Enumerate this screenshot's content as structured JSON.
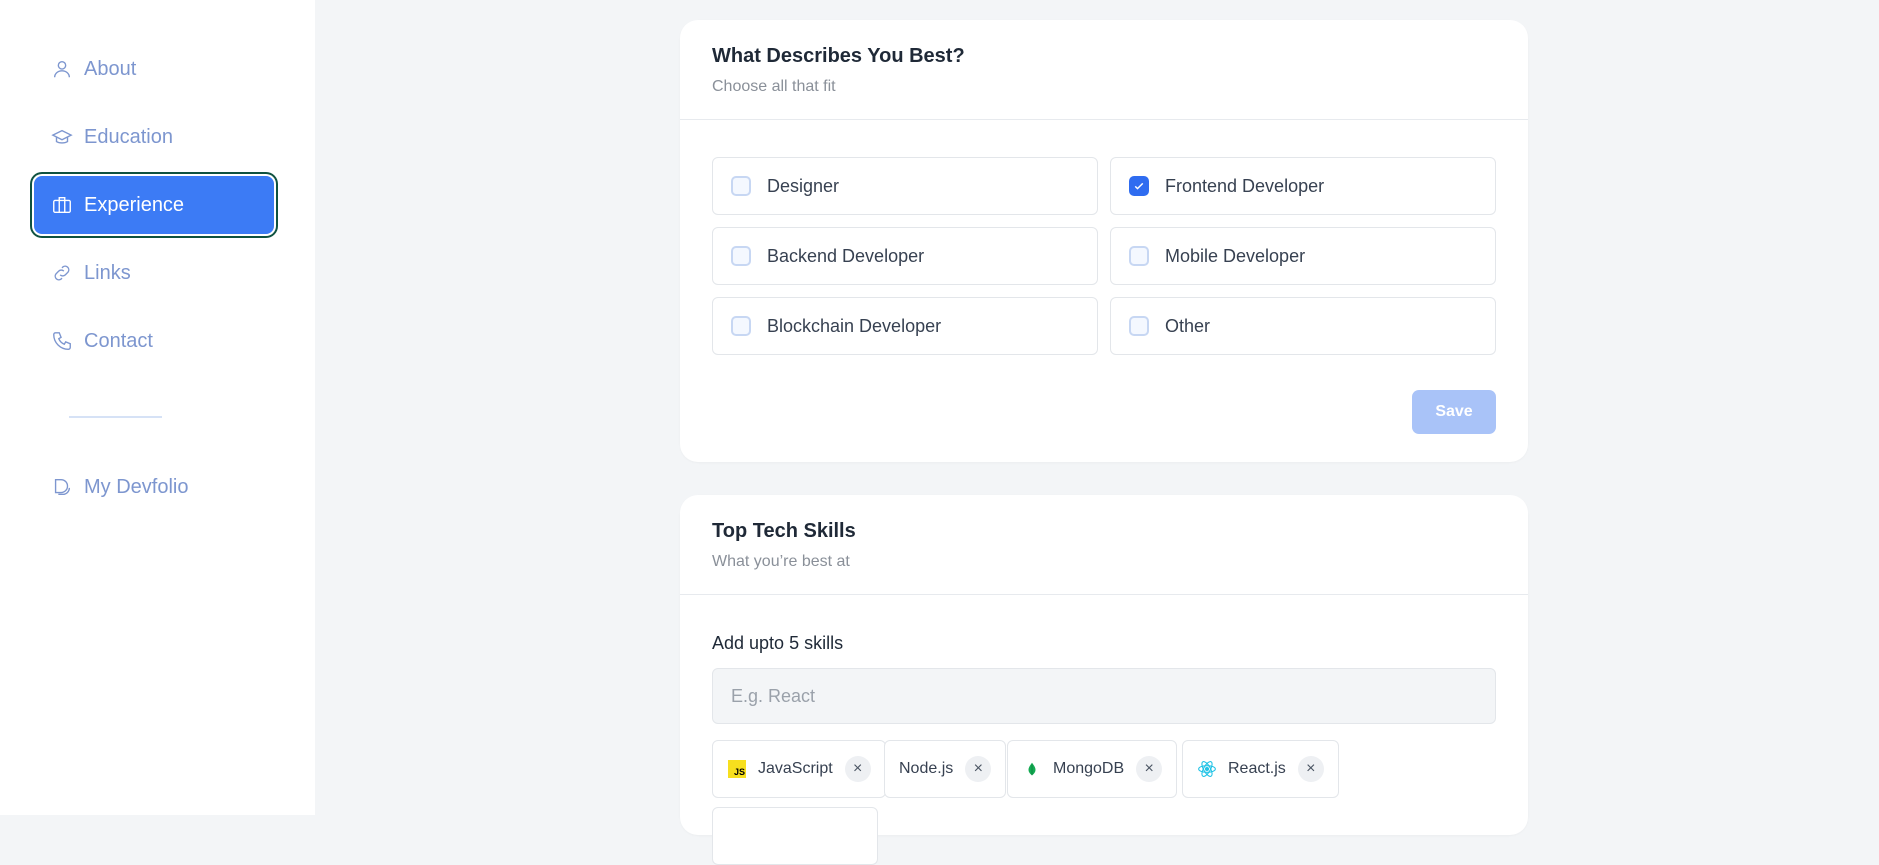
{
  "sidebar": {
    "items": [
      {
        "label": "About",
        "icon": "user-icon"
      },
      {
        "label": "Education",
        "icon": "graduation-cap-icon"
      },
      {
        "label": "Experience",
        "icon": "briefcase-icon",
        "active": true
      },
      {
        "label": "Links",
        "icon": "link-icon"
      },
      {
        "label": "Contact",
        "icon": "phone-icon"
      }
    ],
    "devfolio": {
      "label": "My Devfolio",
      "icon": "devfolio-logo-icon"
    }
  },
  "describes": {
    "title": "What Describes You Best?",
    "subtitle": "Choose all that fit",
    "options": [
      {
        "label": "Designer",
        "checked": false
      },
      {
        "label": "Frontend Developer",
        "checked": true
      },
      {
        "label": "Backend Developer",
        "checked": false
      },
      {
        "label": "Mobile Developer",
        "checked": false
      },
      {
        "label": "Blockchain Developer",
        "checked": false
      },
      {
        "label": "Other",
        "checked": false
      }
    ],
    "save_label": "Save"
  },
  "skills": {
    "title": "Top Tech Skills",
    "subtitle": "What you’re best at",
    "label": "Add upto 5 skills",
    "placeholder": "E.g. React",
    "chips": [
      {
        "label": "JavaScript",
        "icon": "javascript-icon"
      },
      {
        "label": "Node.js",
        "icon": ""
      },
      {
        "label": "MongoDB",
        "icon": "mongodb-leaf-icon"
      },
      {
        "label": "React.js",
        "icon": "react-icon"
      }
    ],
    "remove_glyph": "×",
    "js_badge": "JS"
  },
  "colors": {
    "accent": "#3c7bf5",
    "active_outline": "#0f5240",
    "nav_text": "#7d96cf",
    "save_disabled": "#a9c3f8"
  }
}
